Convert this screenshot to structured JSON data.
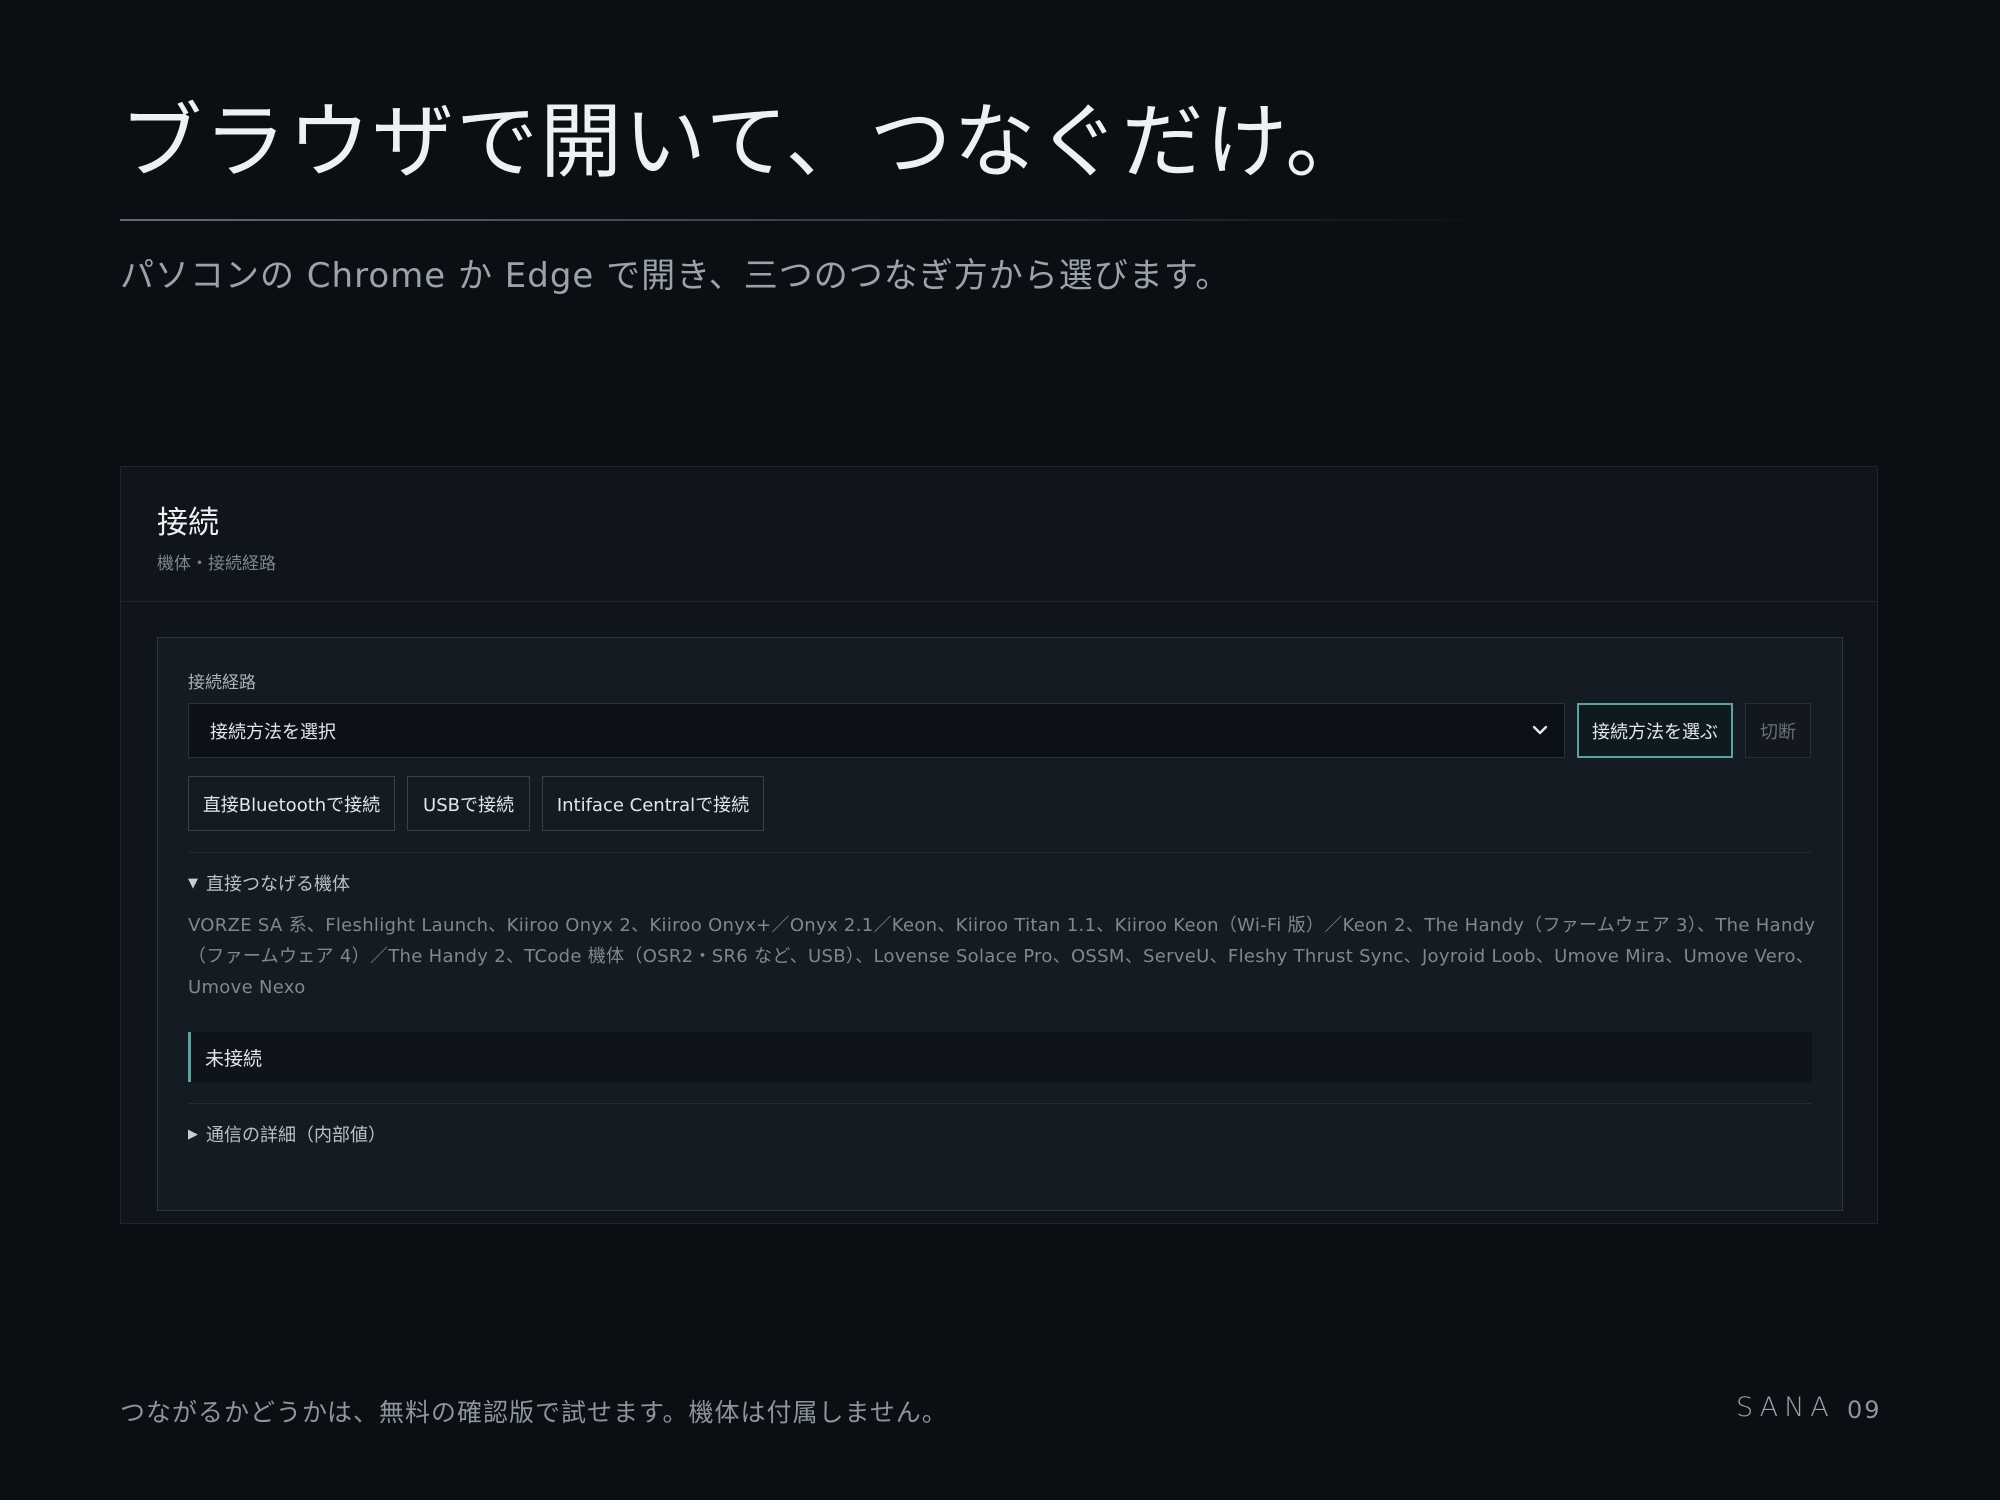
{
  "slide": {
    "title": "ブラウザで開いて、つなぐだけ。",
    "subtitle": "パソコンの Chrome か Edge で開き、三つのつなぎ方から選びます。"
  },
  "card": {
    "title": "接続",
    "subtitle": "機体・接続経路",
    "route_label": "接続経路",
    "select": {
      "value": "接続方法を選択",
      "icon": "chevron-down-icon"
    },
    "buttons": {
      "choose": "接続方法を選ぶ",
      "disconnect": "切断",
      "bluetooth": "直接Bluetoothで接続",
      "usb": "USBで接続",
      "intiface": "Intiface Centralで接続"
    },
    "devices_heading": "直接つなげる機体",
    "devices_text": "VORZE SA 系、Fleshlight Launch、Kiiroo Onyx 2、Kiiroo Onyx+／Onyx 2.1／Keon、Kiiroo Titan 1.1、Kiiroo Keon（Wi-Fi 版）／Keon 2、The Handy（ファームウェア 3）、The Handy（ファームウェア 4）／The Handy 2、TCode 機体（OSR2・SR6 など、USB）、Lovense Solace Pro、OSSM、ServeU、Fleshy Thrust Sync、Joyroid Loob、Umove Mira、Umove Vero、Umove Nexo",
    "status": "未接続",
    "details_heading": "通信の詳細（内部値）"
  },
  "footer": {
    "note": "つながるかどうかは、無料の確認版で試せます。機体は付属しません。",
    "brand": "SANA",
    "page": "09"
  },
  "colors": {
    "background": "#0b0f13",
    "accent": "#5aa3a0"
  }
}
